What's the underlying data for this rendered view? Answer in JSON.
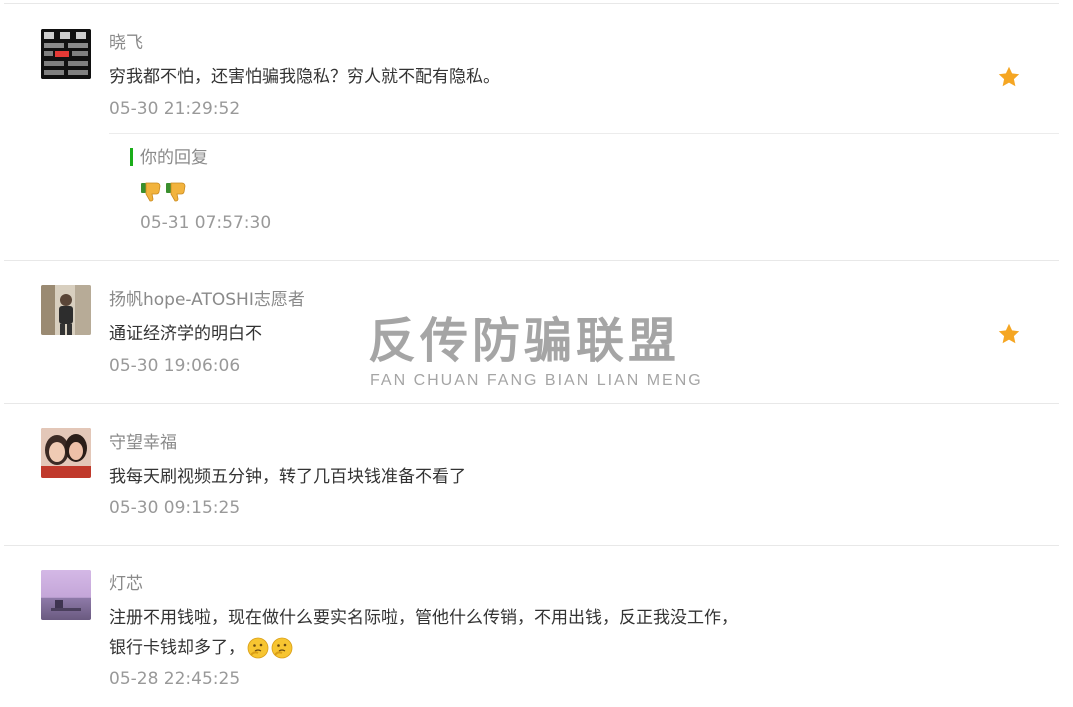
{
  "comments": [
    {
      "nickname": "晓飞",
      "content": "穷我都不怕，还害怕骗我隐私？穷人就不配有隐私。",
      "time": "05-30 21:29:52",
      "starred": true,
      "avatar_icon": "app-grid-avatar",
      "reply": {
        "label": "你的回复",
        "emojis": [
          "thumbs-down-emoji",
          "thumbs-down-emoji"
        ],
        "time": "05-31 07:57:30"
      }
    },
    {
      "nickname": "扬帆hope-ATOSHI志愿者",
      "content": "通证经济学的明白不",
      "time": "05-30 19:06:06",
      "starred": true,
      "avatar_icon": "person-photo-avatar"
    },
    {
      "nickname": "守望幸福",
      "content": "我每天刷视频五分钟，转了几百块钱准备不看了",
      "time": "05-30 09:15:25",
      "starred": false,
      "avatar_icon": "couple-photo-avatar"
    },
    {
      "nickname": "灯芯",
      "content_line1": "注册不用钱啦，现在做什么要实名际啦，管他什么传销，不用出钱，反正我没工作，",
      "content_line2": "银行卡钱却多了，",
      "content_emojis": [
        "thinking-emoji",
        "thinking-emoji"
      ],
      "time": "05-28 22:45:25",
      "starred": false,
      "avatar_icon": "sunset-landscape-avatar"
    }
  ],
  "watermark": {
    "text_cn": "反传防骗联盟",
    "text_en": "FAN CHUAN FANG BIAN LIAN MENG"
  },
  "colors": {
    "star": "#f5a623",
    "reply_bar": "#1aad19",
    "nickname": "#8a8a8a",
    "time": "#999999",
    "content": "#333333"
  }
}
